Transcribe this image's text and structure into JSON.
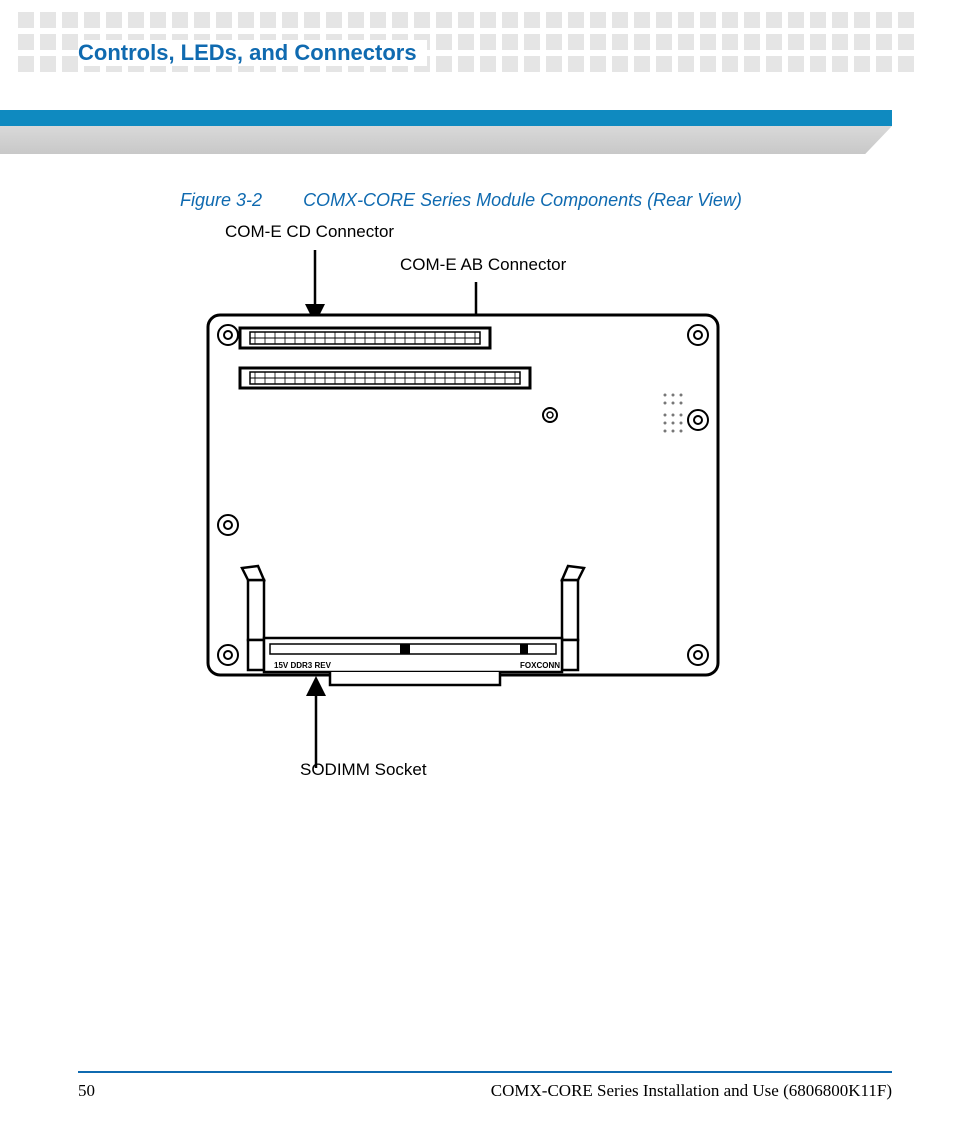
{
  "section_title": "Controls, LEDs, and Connectors",
  "figure": {
    "number": "Figure 3-2",
    "title": "COMX-CORE Series Module Components (Rear View)"
  },
  "diagram": {
    "labels": {
      "com_e_cd": "COM-E CD Connector",
      "com_e_ab": "COM-E AB Connector",
      "sodimm": "SODIMM Socket"
    },
    "board_markings": {
      "left": "15V DDR3 REV",
      "right": "FOXCONN"
    }
  },
  "footer": {
    "page": "50",
    "doc": "COMX-CORE Series Installation and Use (6806800K11F)"
  }
}
